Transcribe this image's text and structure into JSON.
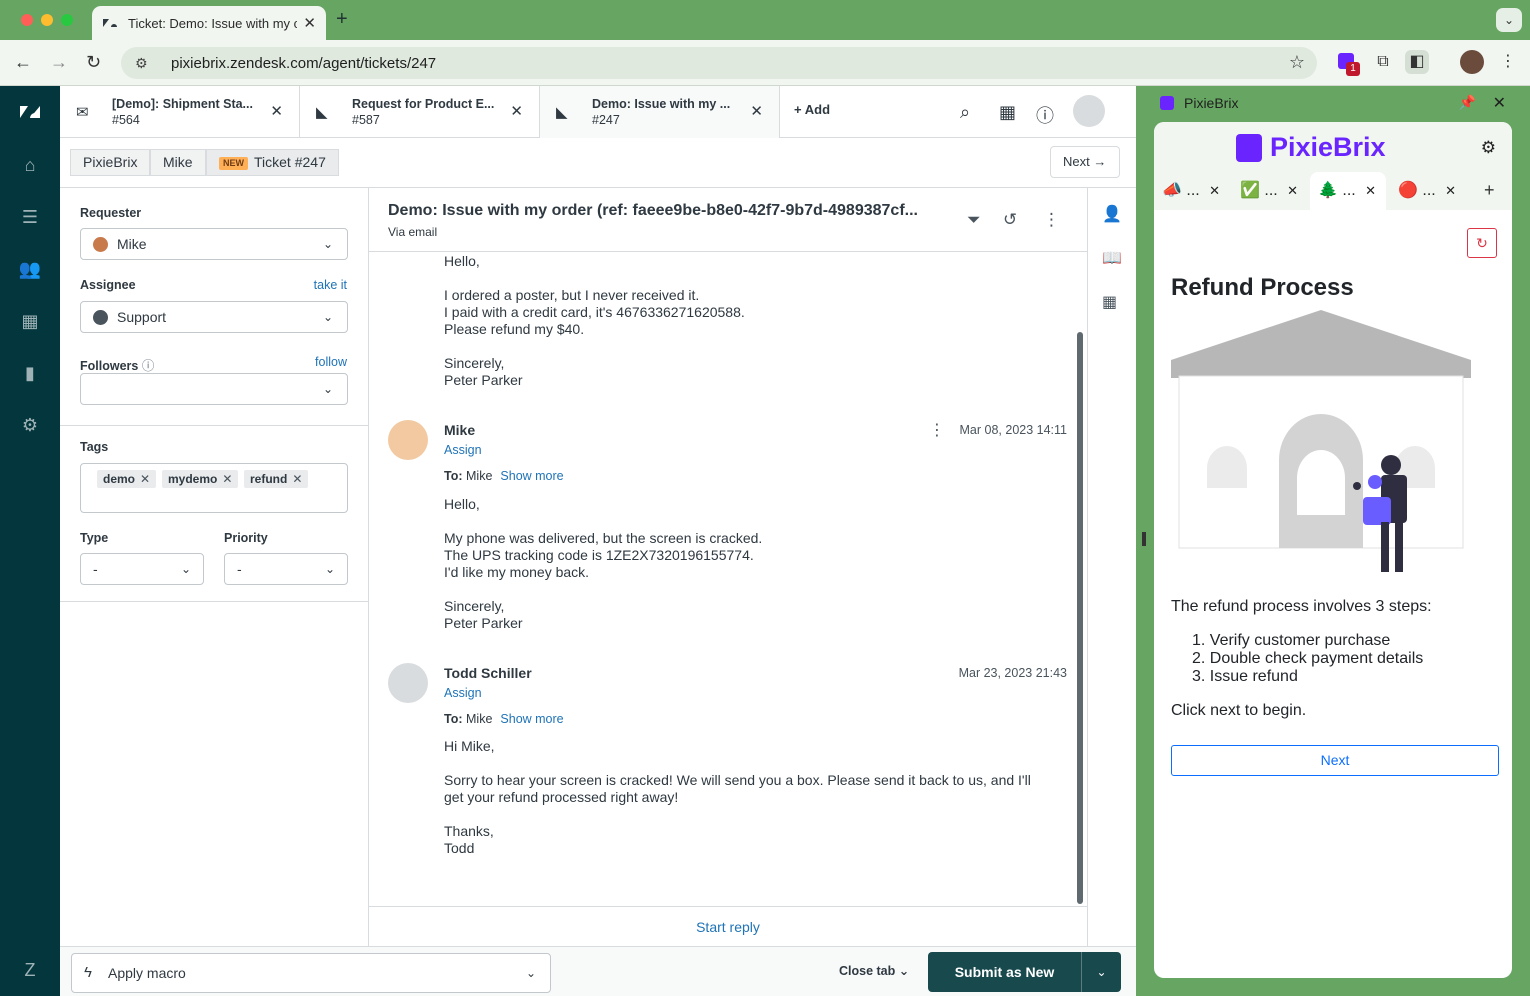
{
  "browser": {
    "tab_title": "Ticket: Demo: Issue with my c",
    "url": "pixiebrix.zendesk.com/agent/tickets/247",
    "extension_badge": "1"
  },
  "zendesk": {
    "tabs": [
      {
        "title": "[Demo]: Shipment Sta...",
        "number": "#564"
      },
      {
        "title": "Request for Product E...",
        "number": "#587"
      },
      {
        "title": "Demo: Issue with my ...",
        "number": "#247"
      }
    ],
    "add_label": "Add",
    "breadcrumbs": {
      "org": "PixieBrix",
      "user": "Mike",
      "badge": "NEW",
      "ticket": "Ticket #247"
    },
    "next_label": "Next",
    "properties": {
      "requester_label": "Requester",
      "requester_value": "Mike",
      "assignee_label": "Assignee",
      "take_it": "take it",
      "assignee_value": "Support",
      "followers_label": "Followers",
      "follow": "follow",
      "tags_label": "Tags",
      "tags": [
        "demo",
        "mydemo",
        "refund"
      ],
      "type_label": "Type",
      "type_value": "-",
      "priority_label": "Priority",
      "priority_value": "-"
    },
    "conversation": {
      "title": "Demo: Issue with my order (ref: faeee9be-b8e0-42f7-9b7d-4989387cf...",
      "via": "Via email",
      "first_message": "Hello,\n\nI ordered a poster, but I never received it.\nI paid with a credit card, it's 4676336271620588.\nPlease refund my $40.\n\nSincerely,\nPeter Parker",
      "messages": [
        {
          "author": "Mike",
          "assign": "Assign",
          "to_label": "To:",
          "to": "Mike",
          "show_more": "Show more",
          "date": "Mar 08, 2023 14:11",
          "body": "Hello,\n\nMy phone was delivered, but the screen is cracked.\nThe UPS tracking code is 1ZE2X7320196155774.\nI'd like my money back.\n\nSincerely,\nPeter Parker"
        },
        {
          "author": "Todd Schiller",
          "assign": "Assign",
          "to_label": "To:",
          "to": "Mike",
          "show_more": "Show more",
          "date": "Mar 23, 2023 21:43",
          "body": "Hi Mike,\n\nSorry to hear your screen is cracked! We will send you a box. Please send it back to us, and I'll\nget your refund processed right away!\n\nThanks,\nTodd"
        }
      ],
      "start_reply": "Start reply"
    },
    "footer": {
      "apply_macro": "Apply macro",
      "close_tab": "Close tab",
      "submit": "Submit as New"
    }
  },
  "pixiebrix": {
    "header": "PixieBrix",
    "logo_text": "PixieBrix",
    "tabs": [
      {
        "icon": "📣",
        "label": "..."
      },
      {
        "icon": "✅",
        "label": "..."
      },
      {
        "icon": "🌲",
        "label": "..."
      },
      {
        "icon": "🔴",
        "label": "..."
      }
    ],
    "panel_title": "Refund Process",
    "description": "The refund process involves 3 steps:",
    "steps": [
      "1. Verify customer purchase",
      "2. Double check payment details",
      "3. Issue refund"
    ],
    "click_next": "Click next to begin.",
    "next_button": "Next",
    "brand_color": "#6a25ff"
  }
}
